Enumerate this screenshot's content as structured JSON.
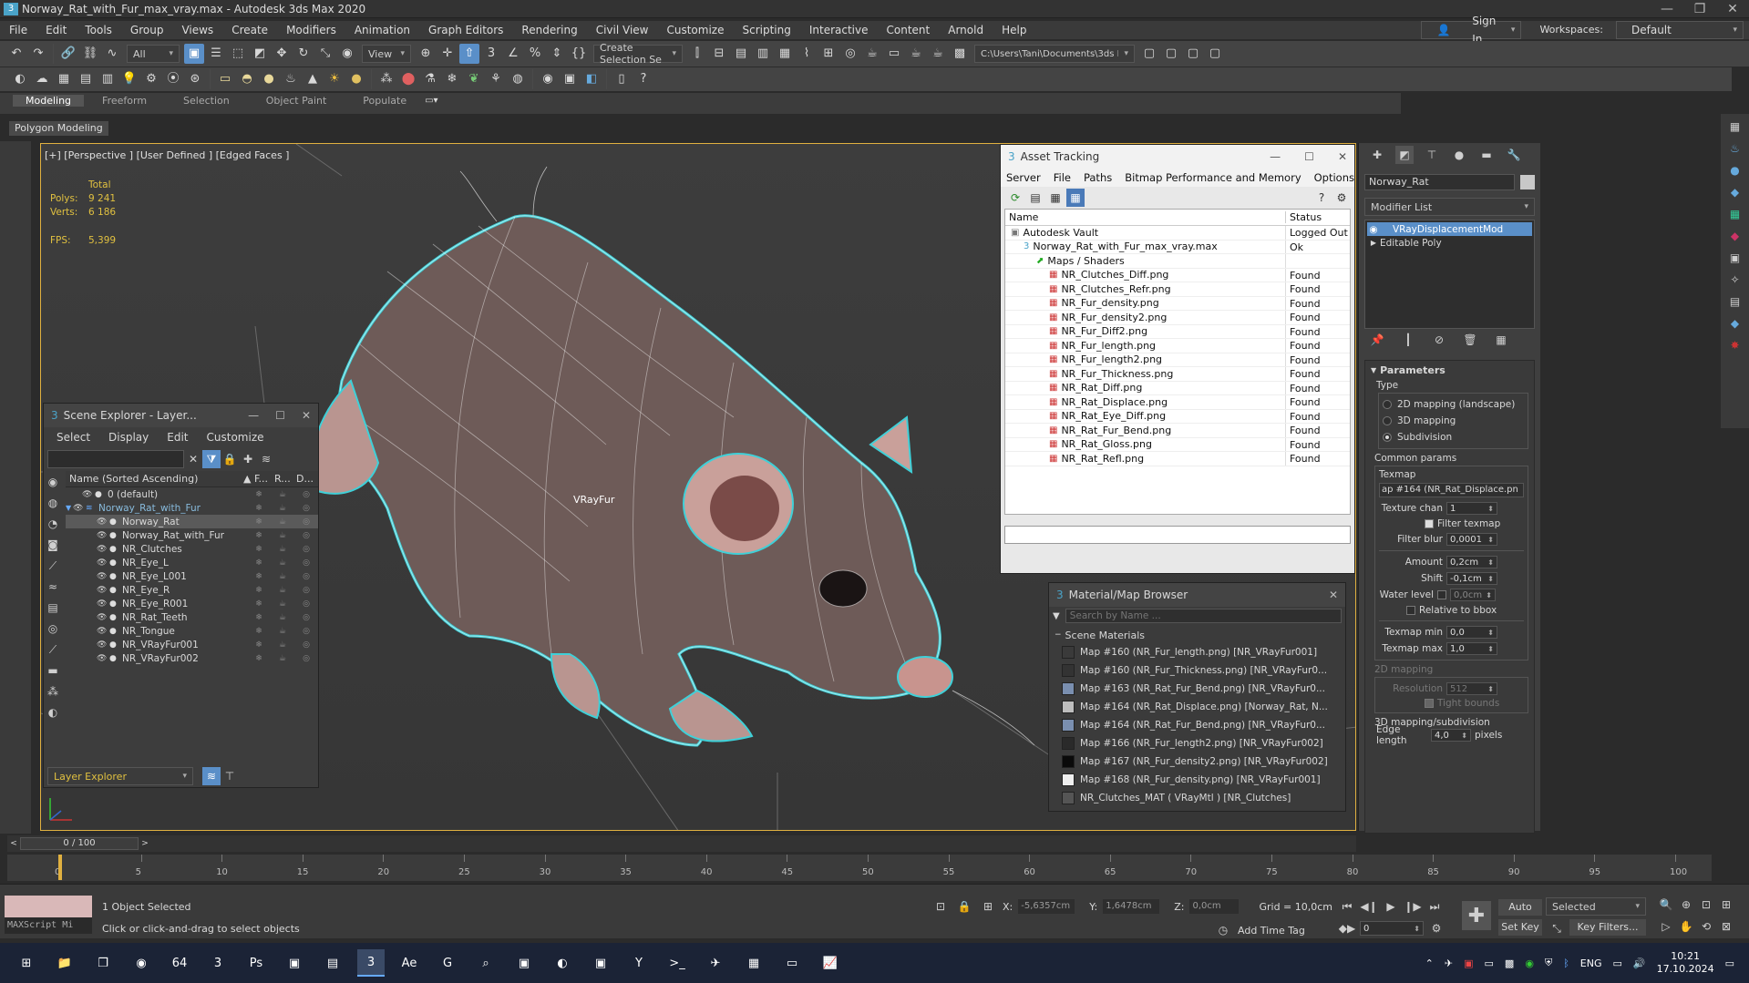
{
  "window": {
    "title": "Norway_Rat_with_Fur_max_vray.max - Autodesk 3ds Max 2020",
    "controls": [
      "—",
      "❐",
      "✕"
    ]
  },
  "menu": [
    "File",
    "Edit",
    "Tools",
    "Group",
    "Views",
    "Create",
    "Modifiers",
    "Animation",
    "Graph Editors",
    "Rendering",
    "Civil View",
    "Customize",
    "Scripting",
    "Interactive",
    "Content",
    "Arnold",
    "Help"
  ],
  "account": {
    "sign_in": "Sign In",
    "workspaces_label": "Workspaces:",
    "workspace": "Default"
  },
  "toolbar": {
    "filter": "All",
    "ref_coord": "View",
    "selection_set": "Create Selection Se",
    "project_path": "C:\\Users\\Tani\\Documents\\3ds Max 2020"
  },
  "ribbon": {
    "tabs": [
      "Modeling",
      "Freeform",
      "Selection",
      "Object Paint",
      "Populate"
    ],
    "sub": "Polygon Modeling"
  },
  "viewport": {
    "label": "[+] [Perspective ] [User Defined ] [Edged Faces ]",
    "stats_total": "Total",
    "polys_label": "Polys:",
    "polys": "9 241",
    "verts_label": "Verts:",
    "verts": "6 186",
    "fps_label": "FPS:",
    "fps": "5,399",
    "tag": "VRayFur"
  },
  "scene_explorer": {
    "title": "Scene Explorer - Layer...",
    "menu": [
      "Select",
      "Display",
      "Edit",
      "Customize"
    ],
    "col_name": "Name (Sorted Ascending)",
    "col_f": "▲ F...",
    "col_r": "R...",
    "col_d": "D...",
    "rows": [
      {
        "label": "0 (default)",
        "indent": 0,
        "selected": false
      },
      {
        "label": "Norway_Rat_with_Fur",
        "indent": 0,
        "selected": false,
        "layer": true
      },
      {
        "label": "Norway_Rat",
        "indent": 1,
        "selected": true
      },
      {
        "label": "Norway_Rat_with_Fur",
        "indent": 1,
        "selected": false
      },
      {
        "label": "NR_Clutches",
        "indent": 1,
        "selected": false
      },
      {
        "label": "NR_Eye_L",
        "indent": 1,
        "selected": false
      },
      {
        "label": "NR_Eye_L001",
        "indent": 1,
        "selected": false
      },
      {
        "label": "NR_Eye_R",
        "indent": 1,
        "selected": false
      },
      {
        "label": "NR_Eye_R001",
        "indent": 1,
        "selected": false
      },
      {
        "label": "NR_Rat_Teeth",
        "indent": 1,
        "selected": false
      },
      {
        "label": "NR_Tongue",
        "indent": 1,
        "selected": false
      },
      {
        "label": "NR_VRayFur001",
        "indent": 1,
        "selected": false
      },
      {
        "label": "NR_VRayFur002",
        "indent": 1,
        "selected": false
      }
    ],
    "footer": "Layer Explorer"
  },
  "asset_tracking": {
    "title": "Asset Tracking",
    "menu": [
      "Server",
      "File",
      "Paths",
      "Bitmap Performance and Memory",
      "Options"
    ],
    "col_name": "Name",
    "col_status": "Status",
    "rows": [
      {
        "name": "Autodesk Vault",
        "status": "Logged Out",
        "level": 0
      },
      {
        "name": "Norway_Rat_with_Fur_max_vray.max",
        "status": "Ok",
        "level": 1
      },
      {
        "name": "Maps / Shaders",
        "status": "",
        "level": 2
      },
      {
        "name": "NR_Clutches_Diff.png",
        "status": "Found",
        "level": 3
      },
      {
        "name": "NR_Clutches_Refr.png",
        "status": "Found",
        "level": 3
      },
      {
        "name": "NR_Fur_density.png",
        "status": "Found",
        "level": 3
      },
      {
        "name": "NR_Fur_density2.png",
        "status": "Found",
        "level": 3
      },
      {
        "name": "NR_Fur_Diff2.png",
        "status": "Found",
        "level": 3
      },
      {
        "name": "NR_Fur_length.png",
        "status": "Found",
        "level": 3
      },
      {
        "name": "NR_Fur_length2.png",
        "status": "Found",
        "level": 3
      },
      {
        "name": "NR_Fur_Thickness.png",
        "status": "Found",
        "level": 3
      },
      {
        "name": "NR_Rat_Diff.png",
        "status": "Found",
        "level": 3
      },
      {
        "name": "NR_Rat_Displace.png",
        "status": "Found",
        "level": 3
      },
      {
        "name": "NR_Rat_Eye_Diff.png",
        "status": "Found",
        "level": 3
      },
      {
        "name": "NR_Rat_Fur_Bend.png",
        "status": "Found",
        "level": 3
      },
      {
        "name": "NR_Rat_Gloss.png",
        "status": "Found",
        "level": 3
      },
      {
        "name": "NR_Rat_Refl.png",
        "status": "Found",
        "level": 3
      }
    ]
  },
  "material_browser": {
    "title": "Material/Map Browser",
    "search_placeholder": "Search by Name ...",
    "group": "Scene Materials",
    "items": [
      {
        "label": "Map #160 (NR_Fur_length.png) [NR_VRayFur001]",
        "swatch": "#3a3a3a"
      },
      {
        "label": "Map #160 (NR_Fur_Thickness.png) [NR_VRayFur0...",
        "swatch": "#333"
      },
      {
        "label": "Map #163 (NR_Rat_Fur_Bend.png) [NR_VRayFur0...",
        "swatch": "#7a8fb0"
      },
      {
        "label": "Map #164 (NR_Rat_Displace.png) [Norway_Rat, N...",
        "swatch": "#bdbdbd"
      },
      {
        "label": "Map #164 (NR_Rat_Fur_Bend.png) [NR_VRayFur0...",
        "swatch": "#7a8fb0"
      },
      {
        "label": "Map #166 (NR_Fur_length2.png) [NR_VRayFur002]",
        "swatch": "#2a2a2a"
      },
      {
        "label": "Map #167 (NR_Fur_density2.png) [NR_VRayFur002]",
        "swatch": "#0a0a0a"
      },
      {
        "label": "Map #168 (NR_Fur_density.png) [NR_VRayFur001]",
        "swatch": "#eeeeee"
      },
      {
        "label": "NR_Clutches_MAT ( VRayMtl ) [NR_Clutches]",
        "swatch": "#555"
      }
    ]
  },
  "command_panel": {
    "object_name": "Norway_Rat",
    "modifier_list": "Modifier List",
    "stack": [
      "VRayDisplacementMod",
      "Editable Poly"
    ],
    "rollout": "Parameters",
    "type_label": "Type",
    "type_options": [
      "2D mapping (landscape)",
      "3D mapping",
      "Subdivision"
    ],
    "type_selected": 2,
    "common_params": "Common params",
    "texmap_label": "Texmap",
    "texmap": "ap #164 (NR_Rat_Displace.pn",
    "texture_chan_label": "Texture chan",
    "texture_chan": "1",
    "filter_texmap": "Filter texmap",
    "filter_blur_label": "Filter blur",
    "filter_blur": "0,0001",
    "amount_label": "Amount",
    "amount": "0,2cm",
    "shift_label": "Shift",
    "shift": "-0,1cm",
    "water_label": "Water level",
    "water": "0,0cm",
    "relative": "Relative to bbox",
    "texmap_min_label": "Texmap min",
    "texmap_min": "0,0",
    "texmap_max_label": "Texmap max",
    "texmap_max": "1,0",
    "mapping_2d": "2D mapping",
    "resolution_label": "Resolution",
    "resolution": "512",
    "tight_bounds": "Tight bounds",
    "mapping_3d": "3D mapping/subdivision",
    "edge_length_label": "Edge length",
    "edge_length": "4,0",
    "pixels": "pixels"
  },
  "timeline": {
    "frame": "0 / 100",
    "ticks": [
      "0",
      "5",
      "10",
      "15",
      "20",
      "25",
      "30",
      "35",
      "40",
      "45",
      "50",
      "55",
      "60",
      "65",
      "70",
      "75",
      "80",
      "85",
      "90",
      "95",
      "100"
    ]
  },
  "status": {
    "maxscript": "MAXScript Mi",
    "selected": "1 Object Selected",
    "hint": "Click or click-and-drag to select objects",
    "x_label": "X:",
    "x": "-5,6357cm",
    "y_label": "Y:",
    "y": "1,6478cm",
    "z_label": "Z:",
    "z": "0,0cm",
    "grid": "Grid = 10,0cm",
    "add_time_tag": "Add Time Tag",
    "frame_field": "0",
    "auto_key": "Auto Key",
    "set_key": "Set Key",
    "selected_dd": "Selected",
    "key_filters": "Key Filters..."
  },
  "taskbar": {
    "apps": [
      "start-icon",
      "file-explorer-icon",
      "task-view-icon",
      "chrome-icon",
      "64-icon",
      "3dsmax-icon",
      "photoshop-icon",
      "app-icon",
      "notepad-icon",
      "3dsmax-active-icon",
      "after-effects-icon",
      "g-icon",
      "search-icon",
      "app2-icon",
      "edge-icon",
      "app3-icon",
      "yandex-icon",
      "terminal-icon",
      "telegram-icon",
      "calculator-icon",
      "window-icon",
      "chart-icon"
    ],
    "lang": "ENG",
    "time": "10:21",
    "date": "17.10.2024"
  }
}
